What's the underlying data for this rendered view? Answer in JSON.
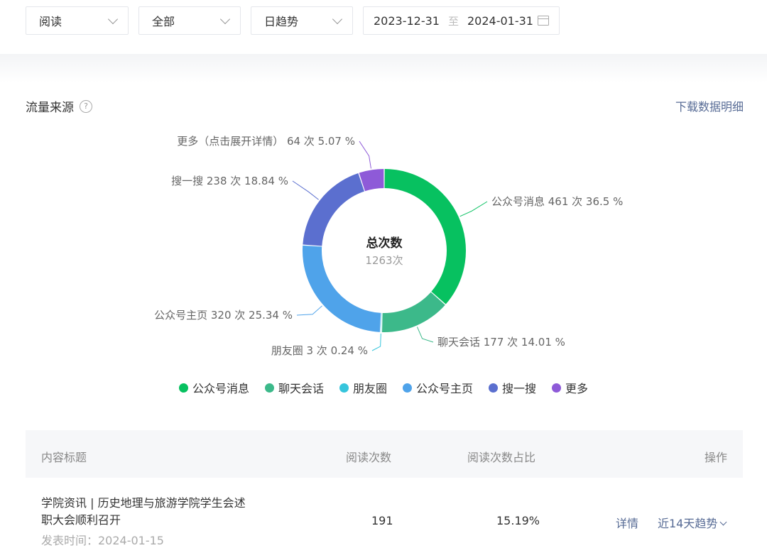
{
  "filters": {
    "metric": "阅读",
    "scope": "全部",
    "granularity": "日趋势",
    "date_start": "2023-12-31",
    "date_sep": "至",
    "date_end": "2024-01-31"
  },
  "section": {
    "title": "流量来源",
    "download_label": "下载数据明细"
  },
  "chart_data": {
    "type": "pie",
    "center_title": "总次数",
    "center_value": "1263次",
    "total": 1263,
    "slices": [
      {
        "name": "公众号消息",
        "value": 461,
        "percent": 36.5,
        "color": "#07c160",
        "label": "公众号消息 461 次 36.5 %"
      },
      {
        "name": "聊天会话",
        "value": 177,
        "percent": 14.01,
        "color": "#3cb98a",
        "label": "聊天会话 177 次 14.01 %"
      },
      {
        "name": "朋友圈",
        "value": 3,
        "percent": 0.24,
        "color": "#36c5dc",
        "label": "朋友圈 3 次 0.24 %"
      },
      {
        "name": "公众号主页",
        "value": 320,
        "percent": 25.34,
        "color": "#4fa3ea",
        "label": "公众号主页 320 次 25.34 %"
      },
      {
        "name": "搜一搜",
        "value": 238,
        "percent": 18.84,
        "color": "#5b6fcf",
        "label": "搜一搜 238 次 18.84 %"
      },
      {
        "name": "更多",
        "value": 64,
        "percent": 5.07,
        "color": "#8e5ad8",
        "label": "更多（点击展开详情） 64 次 5.07 %"
      }
    ],
    "legend": [
      "公众号消息",
      "聊天会话",
      "朋友圈",
      "公众号主页",
      "搜一搜",
      "更多"
    ]
  },
  "table": {
    "headers": {
      "title": "内容标题",
      "reads": "阅读次数",
      "ratio": "阅读次数占比",
      "ops": "操作"
    },
    "rows": [
      {
        "title": "学院资讯 | 历史地理与旅游学院学生会述职大会顺利召开",
        "publish": "发表时间：2024-01-15",
        "reads": "191",
        "ratio": "15.19%",
        "detail": "详情",
        "trend": "近14天趋势"
      }
    ]
  }
}
